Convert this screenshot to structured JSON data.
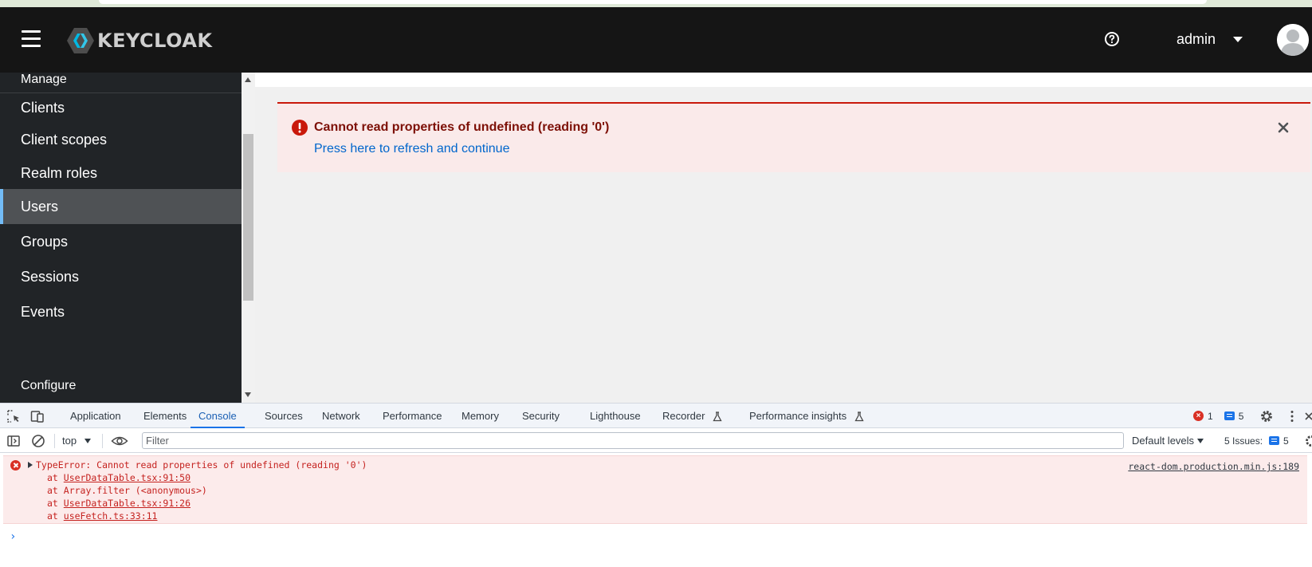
{
  "header": {
    "logo_text": "KEYCLOAK",
    "username": "admin",
    "menu_icon": "hamburger-icon",
    "help_icon": "help-icon",
    "avatar_icon": "avatar"
  },
  "sidebar": {
    "sections": {
      "manage": "Manage",
      "configure": "Configure"
    },
    "items": [
      {
        "label": "Clients",
        "active": false
      },
      {
        "label": "Client scopes",
        "active": false
      },
      {
        "label": "Realm roles",
        "active": false
      },
      {
        "label": "Users",
        "active": true
      },
      {
        "label": "Groups",
        "active": false
      },
      {
        "label": "Sessions",
        "active": false
      },
      {
        "label": "Events",
        "active": false
      }
    ]
  },
  "alert": {
    "title": "Cannot read properties of undefined (reading '0')",
    "link": "Press here to refresh and continue",
    "variant": "danger"
  },
  "devtools": {
    "tabs": [
      {
        "label": "Application",
        "active": false
      },
      {
        "label": "Elements",
        "active": false
      },
      {
        "label": "Console",
        "active": true
      },
      {
        "label": "Sources",
        "active": false
      },
      {
        "label": "Network",
        "active": false
      },
      {
        "label": "Performance",
        "active": false
      },
      {
        "label": "Memory",
        "active": false
      },
      {
        "label": "Security",
        "active": false
      },
      {
        "label": "Lighthouse",
        "active": false
      },
      {
        "label": "Recorder",
        "active": false
      },
      {
        "label": "Performance insights",
        "active": false
      }
    ],
    "error_count": "1",
    "message_count": "5",
    "context": "top",
    "filter_placeholder": "Filter",
    "levels": "Default levels",
    "issues_label": "5 Issues:",
    "issues_count": "5"
  },
  "console": {
    "error_message": "TypeError: Cannot read properties of undefined (reading '0')",
    "source": "react-dom.production.min.js:189",
    "stack": [
      {
        "prefix": "at ",
        "location": "UserDataTable.tsx:91:50",
        "linked": true
      },
      {
        "prefix": "at ",
        "location": "Array.filter (<anonymous>)",
        "linked": false
      },
      {
        "prefix": "at ",
        "location": "UserDataTable.tsx:91:26",
        "linked": true
      },
      {
        "prefix": "at ",
        "location": "useFetch.ts:33:11",
        "linked": true
      }
    ],
    "prompt": "›"
  },
  "colors": {
    "header_bg": "#151515",
    "sidebar_bg": "#212427",
    "active_accent": "#73bcf7",
    "danger": "#c9190b",
    "link": "#0066cc",
    "devtools_active": "#1a73e8"
  }
}
